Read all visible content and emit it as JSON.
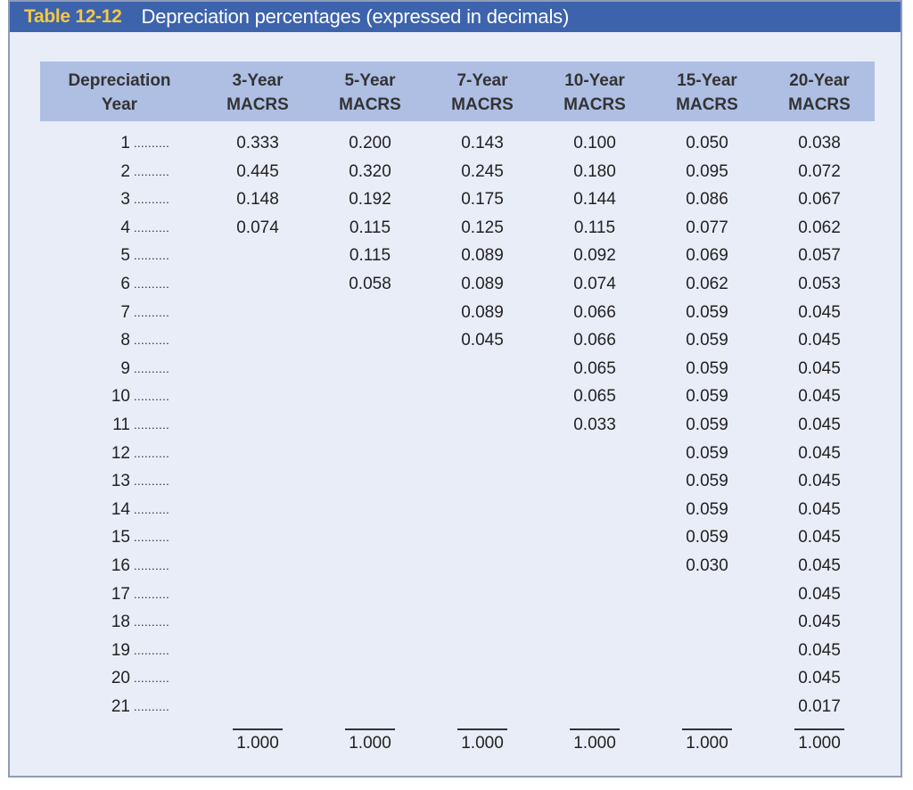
{
  "table_number": "Table 12-12",
  "title": "Depreciation percentages (expressed in decimals)",
  "headers": [
    {
      "line1": "Depreciation",
      "line2": "Year"
    },
    {
      "line1": "3-Year",
      "line2": "MACRS"
    },
    {
      "line1": "5-Year",
      "line2": "MACRS"
    },
    {
      "line1": "7-Year",
      "line2": "MACRS"
    },
    {
      "line1": "10-Year",
      "line2": "MACRS"
    },
    {
      "line1": "15-Year",
      "line2": "MACRS"
    },
    {
      "line1": "20-Year",
      "line2": "MACRS"
    }
  ],
  "leader_dots": "..........",
  "years": [
    "1",
    "2",
    "3",
    "4",
    "5",
    "6",
    "7",
    "8",
    "9",
    "10",
    "11",
    "12",
    "13",
    "14",
    "15",
    "16",
    "17",
    "18",
    "19",
    "20",
    "21"
  ],
  "columns": [
    [
      "0.333",
      "0.445",
      "0.148",
      "0.074"
    ],
    [
      "0.200",
      "0.320",
      "0.192",
      "0.115",
      "0.115",
      "0.058"
    ],
    [
      "0.143",
      "0.245",
      "0.175",
      "0.125",
      "0.089",
      "0.089",
      "0.089",
      "0.045"
    ],
    [
      "0.100",
      "0.180",
      "0.144",
      "0.115",
      "0.092",
      "0.074",
      "0.066",
      "0.066",
      "0.065",
      "0.065",
      "0.033"
    ],
    [
      "0.050",
      "0.095",
      "0.086",
      "0.077",
      "0.069",
      "0.062",
      "0.059",
      "0.059",
      "0.059",
      "0.059",
      "0.059",
      "0.059",
      "0.059",
      "0.059",
      "0.059",
      "0.030"
    ],
    [
      "0.038",
      "0.072",
      "0.067",
      "0.062",
      "0.057",
      "0.053",
      "0.045",
      "0.045",
      "0.045",
      "0.045",
      "0.045",
      "0.045",
      "0.045",
      "0.045",
      "0.045",
      "0.045",
      "0.045",
      "0.045",
      "0.045",
      "0.045",
      "0.017"
    ]
  ],
  "totals": [
    "1.000",
    "1.000",
    "1.000",
    "1.000",
    "1.000",
    "1.000"
  ]
}
